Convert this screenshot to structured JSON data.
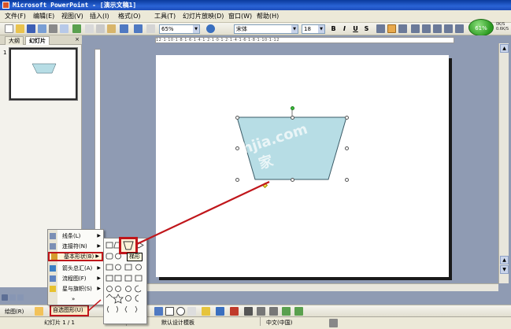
{
  "window": {
    "title": "Microsoft PowerPoint - [演示文稿1]"
  },
  "menu": [
    "文件(F)",
    "编辑(E)",
    "视图(V)",
    "插入(I)",
    "格式(O)",
    "工具(T)",
    "幻灯片放映(D)",
    "窗口(W)",
    "帮助(H)"
  ],
  "toolbar": {
    "zoom": "65%",
    "font_name": "宋体",
    "font_size": "18",
    "bold": "B",
    "italic": "I",
    "underline": "U",
    "shadow": "S"
  },
  "net_widget": {
    "percent": "61%",
    "speed_up": "0K/S",
    "speed_down": "0.6K/S"
  },
  "pane": {
    "tab_outline": "大纲",
    "tab_slides": "幻灯片",
    "close": "×",
    "slide_number": "1"
  },
  "ruler": {
    "marks": "12·1·10·1·8·1·6·1·4·1·2·1·0·1·2·1·4·1·6·1·8·1·10·1·12"
  },
  "watermark": {
    "line1": "hjia.com",
    "line2": "家"
  },
  "drawing_toolbar": {
    "draw_label": "绘图(R)",
    "autoshape_label": "自选图形(U)"
  },
  "autoshape_menu": [
    {
      "label": "线条(L)",
      "submenu": "▶"
    },
    {
      "label": "连接符(N)",
      "submenu": "▶"
    },
    {
      "label": "基本形状(B)",
      "submenu": "▶"
    },
    {
      "label": "箭头总汇(A)",
      "submenu": "▶"
    },
    {
      "label": "流程图(F)",
      "submenu": "▶"
    },
    {
      "label": "星与旗帜(S)",
      "submenu": "▶"
    },
    {
      "label": "»",
      "submenu": ""
    }
  ],
  "shape_tooltip": "梯形",
  "status": {
    "slide": "幻灯片 1 / 1",
    "template": "默认设计模板",
    "language": "中文(中国)"
  },
  "colors": {
    "highlight": "#c0161b",
    "shape_fill": "#b7dde5",
    "shape_stroke": "#3a5a66",
    "title_bar": "#1c4cbc"
  }
}
